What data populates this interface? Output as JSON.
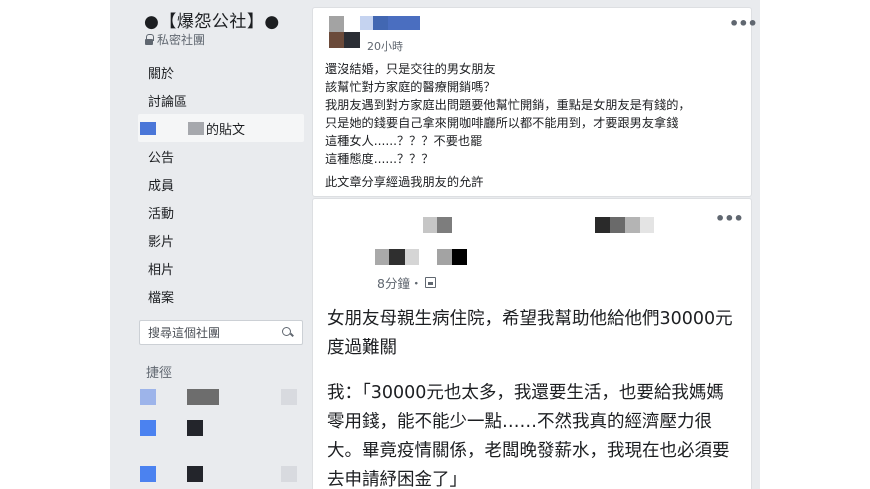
{
  "group": {
    "name": "●【爆怨公社】●",
    "privacy": "私密社團"
  },
  "sidebar": {
    "items": [
      {
        "label": "關於"
      },
      {
        "label": "討論區"
      },
      {
        "label": "的貼文"
      },
      {
        "label": "公告"
      },
      {
        "label": "成員"
      },
      {
        "label": "活動"
      },
      {
        "label": "影片"
      },
      {
        "label": "相片"
      },
      {
        "label": "檔案"
      }
    ],
    "search_placeholder": "搜尋這個社團",
    "shortcuts_title": "捷徑"
  },
  "post1": {
    "time": "20小時",
    "more": "•••",
    "lines": [
      "還沒結婚，只是交往的男女朋友",
      "該幫忙對方家庭的醫療開銷嗎？",
      "我朋友遇到對方家庭出問題要他幫忙開銷，重點是女朋友是有錢的，",
      "只是她的錢要自己拿來開咖啡廳所以都不能用到，才要跟男友拿錢",
      "這種女人......？？？不要也罷",
      "這種態度......？？？"
    ],
    "note": "此文章分享經過我朋友的允許"
  },
  "post2": {
    "time": "8分鐘・",
    "more": "•••",
    "paragraphs": [
      [
        "女朋友母親生病住院，希望我幫助他給他們30000元",
        "度過難關"
      ],
      [
        "我：「30000元也太多，我還要生活，也要給我媽媽",
        "零用錢，能不能少一點……不然我真的經濟壓力很",
        "大。畢竟疫情關係，老闆晚發薪水，我現在也必須要",
        "去申請紓困金了」"
      ]
    ]
  },
  "colors": {
    "frame_bg": "#e9ebee",
    "card_bg": "#ffffff",
    "facebook_blue": "#4267b2"
  }
}
